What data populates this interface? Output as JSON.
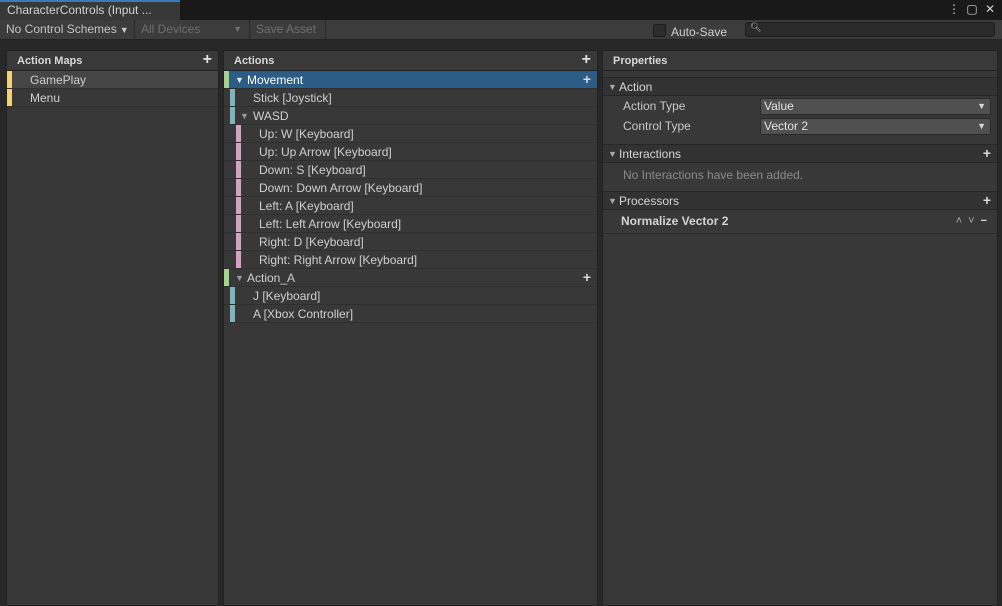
{
  "window": {
    "tab_title": "CharacterControls (Input ...",
    "icons": [
      "more-vert-icon",
      "maximize-icon",
      "close-icon"
    ]
  },
  "toolbar": {
    "control_schemes": "No Control Schemes",
    "devices": "All Devices",
    "save_asset": "Save Asset",
    "auto_save": "Auto-Save",
    "auto_save_checked": false,
    "search_placeholder": ""
  },
  "action_maps": {
    "header": "Action Maps",
    "items": [
      {
        "label": "GamePlay",
        "selected": true
      },
      {
        "label": "Menu",
        "selected": false
      }
    ]
  },
  "actions": {
    "header": "Actions",
    "rows": [
      {
        "label": "Movement"
      },
      {
        "label": "Stick [Joystick]"
      },
      {
        "label": "WASD"
      },
      {
        "label": "Up: W [Keyboard]"
      },
      {
        "label": "Up: Up Arrow [Keyboard]"
      },
      {
        "label": "Down: S [Keyboard]"
      },
      {
        "label": "Down: Down Arrow [Keyboard]"
      },
      {
        "label": "Left: A [Keyboard]"
      },
      {
        "label": "Left: Left Arrow [Keyboard]"
      },
      {
        "label": "Right: D [Keyboard]"
      },
      {
        "label": "Right: Right Arrow [Keyboard]"
      },
      {
        "label": "Action_A"
      },
      {
        "label": "J [Keyboard]"
      },
      {
        "label": "A [Xbox Controller]"
      }
    ]
  },
  "properties": {
    "header": "Properties",
    "action_section": "Action",
    "action_type_label": "Action Type",
    "action_type_value": "Value",
    "control_type_label": "Control Type",
    "control_type_value": "Vector 2",
    "interactions_section": "Interactions",
    "interactions_empty": "No Interactions have been added.",
    "processors_section": "Processors",
    "processor_item": "Normalize Vector 2"
  },
  "colors": {
    "accent_selected": "#2c5d87",
    "map_bar": "#f0d27a",
    "action_bar": "#a5d38b",
    "binding_bar": "#7fb4bf",
    "composite_part_bar": "#d4a3c4"
  }
}
